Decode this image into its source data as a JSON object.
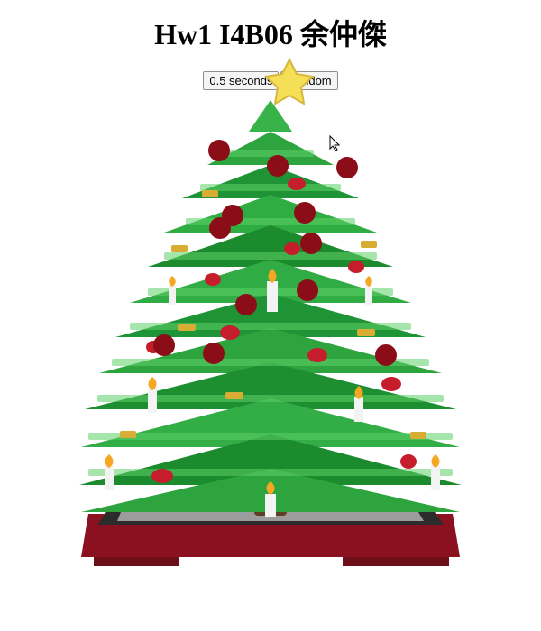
{
  "page": {
    "title": "Hw1 I4B06 余仲傑"
  },
  "controls": {
    "interval_label": "0.5 seconds",
    "random_label": "Random"
  },
  "scene": {
    "background_color": "#ffffff",
    "tree_colors": {
      "green_dark": "#1c8b2d",
      "green_mid": "#2ea43f",
      "green_light": "#52c25c",
      "base_red": "#8b1020",
      "base_dark": "#2c2c2c",
      "star_yellow": "#f4df57",
      "ornament_red": "#c61d2d",
      "candle_white": "#f3f3f3",
      "flame_orange": "#f5a623",
      "gold": "#d9ad33"
    },
    "overlay_dot_color": "#8a0d17",
    "overlay_dot_count": 12
  },
  "icons": {
    "cursor": "mouse-pointer-icon",
    "star": "star-icon"
  }
}
